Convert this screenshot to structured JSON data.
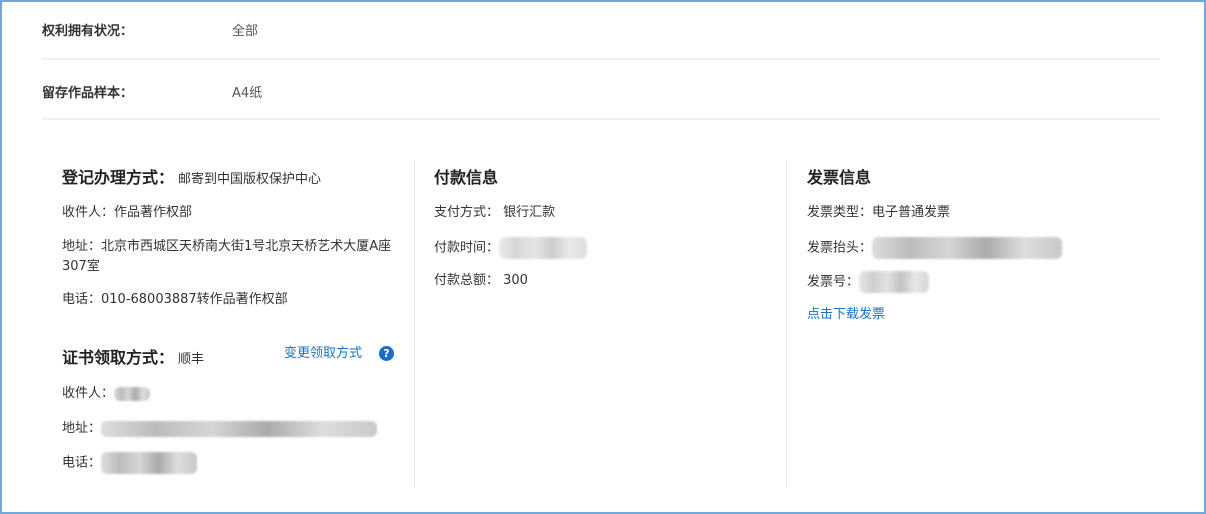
{
  "rows": [
    {
      "label": "权利拥有状况：",
      "value": "全部"
    },
    {
      "label": "留存作品样本：",
      "value": "A4纸"
    }
  ],
  "registration": {
    "title": "登记办理方式：",
    "method": "邮寄到中国版权保护中心",
    "recipient": "收件人：作品著作权部",
    "address": "地址：北京市西城区天桥南大街1号北京天桥艺术大厦A座307室",
    "phone": "电话：010-68003887转作品著作权部"
  },
  "certificate": {
    "title": "证书领取方式：",
    "method": "顺丰",
    "change_link": "变更领取方式",
    "help_icon": "?",
    "recipient_label": "收件人：",
    "address_label": "地址：",
    "phone_label": "电话："
  },
  "payment": {
    "title": "付款信息",
    "method": "支付方式： 银行汇款",
    "time_label": "付款时间：",
    "total": "付款总额： 300"
  },
  "invoice": {
    "title": "发票信息",
    "type": "发票类型：电子普通发票",
    "header_label": "发票抬头：",
    "number_label": "发票号：",
    "download_link": "点击下载发票"
  }
}
